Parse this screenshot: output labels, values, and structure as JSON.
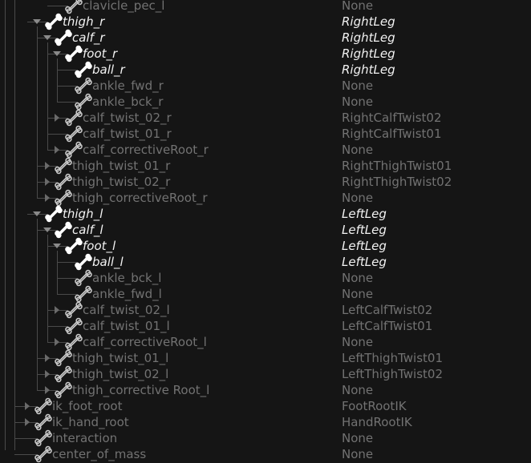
{
  "colors": {
    "background": "#151515",
    "text_active": "#f2f2f2",
    "text_inactive": "#727272",
    "tree_line": "#4a4a4a"
  },
  "bone_icon": "bone-icon",
  "rows": [
    {
      "name": "clavicle_pec_l",
      "value": "None",
      "depth": 5,
      "expander": "none",
      "active": false
    },
    {
      "name": "thigh_r",
      "value": "RightLeg",
      "depth": 3,
      "expander": "expanded",
      "active": true
    },
    {
      "name": "calf_r",
      "value": "RightLeg",
      "depth": 4,
      "expander": "expanded",
      "active": true
    },
    {
      "name": "foot_r",
      "value": "RightLeg",
      "depth": 5,
      "expander": "expanded",
      "active": true
    },
    {
      "name": "ball_r",
      "value": "RightLeg",
      "depth": 6,
      "expander": "none",
      "active": true
    },
    {
      "name": "ankle_fwd_r",
      "value": "None",
      "depth": 6,
      "expander": "none",
      "active": false
    },
    {
      "name": "ankle_bck_r",
      "value": "None",
      "depth": 6,
      "expander": "none",
      "active": false
    },
    {
      "name": "calf_twist_02_r",
      "value": "RightCalfTwist02",
      "depth": 5,
      "expander": "collapsed",
      "active": false
    },
    {
      "name": "calf_twist_01_r",
      "value": "RightCalfTwist01",
      "depth": 5,
      "expander": "none",
      "active": false
    },
    {
      "name": "calf_correctiveRoot_r",
      "value": "None",
      "depth": 5,
      "expander": "collapsed",
      "active": false
    },
    {
      "name": "thigh_twist_01_r",
      "value": "RightThighTwist01",
      "depth": 4,
      "expander": "collapsed",
      "active": false
    },
    {
      "name": "thigh_twist_02_r",
      "value": "RightThighTwist02",
      "depth": 4,
      "expander": "collapsed",
      "active": false
    },
    {
      "name": "thigh_correctiveRoot_r",
      "value": "None",
      "depth": 4,
      "expander": "collapsed",
      "active": false
    },
    {
      "name": "thigh_l",
      "value": "LeftLeg",
      "depth": 3,
      "expander": "expanded",
      "active": true
    },
    {
      "name": "calf_l",
      "value": "LeftLeg",
      "depth": 4,
      "expander": "expanded",
      "active": true
    },
    {
      "name": "foot_l",
      "value": "LeftLeg",
      "depth": 5,
      "expander": "expanded",
      "active": true
    },
    {
      "name": "ball_l",
      "value": "LeftLeg",
      "depth": 6,
      "expander": "none",
      "active": true
    },
    {
      "name": "ankle_bck_l",
      "value": "None",
      "depth": 6,
      "expander": "none",
      "active": false
    },
    {
      "name": "ankle_fwd_l",
      "value": "None",
      "depth": 6,
      "expander": "none",
      "active": false
    },
    {
      "name": "calf_twist_02_l",
      "value": "LeftCalfTwist02",
      "depth": 5,
      "expander": "collapsed",
      "active": false
    },
    {
      "name": "calf_twist_01_l",
      "value": "LeftCalfTwist01",
      "depth": 5,
      "expander": "none",
      "active": false
    },
    {
      "name": "calf_correctiveRoot_l",
      "value": "None",
      "depth": 5,
      "expander": "collapsed",
      "active": false
    },
    {
      "name": "thigh_twist_01_l",
      "value": "LeftThighTwist01",
      "depth": 4,
      "expander": "collapsed",
      "active": false
    },
    {
      "name": "thigh_twist_02_l",
      "value": "LeftThighTwist02",
      "depth": 4,
      "expander": "collapsed",
      "active": false
    },
    {
      "name": "thigh_corrective Root_l",
      "value": "None",
      "depth": 4,
      "expander": "collapsed",
      "active": false
    },
    {
      "name": "ik_foot_root",
      "value": "FootRootIK",
      "depth": 2,
      "expander": "collapsed",
      "active": false
    },
    {
      "name": "ik_hand_root",
      "value": "HandRootIK",
      "depth": 2,
      "expander": "collapsed",
      "active": false
    },
    {
      "name": "interaction",
      "value": "None",
      "depth": 2,
      "expander": "none",
      "active": false
    },
    {
      "name": "center_of_mass",
      "value": "None",
      "depth": 2,
      "expander": "none",
      "active": false
    }
  ]
}
